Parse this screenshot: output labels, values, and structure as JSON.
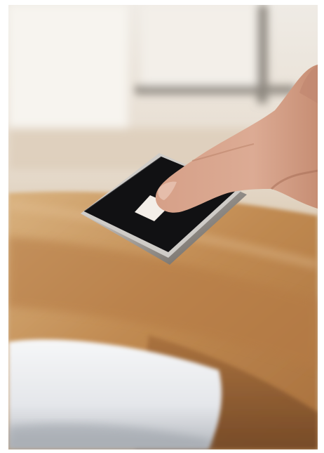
{
  "photo": {
    "subject": "finger-tapping-remote-control",
    "colors": {
      "page_background": "#ffffff",
      "bright_background": "#ece5da",
      "window_frame": "#7d7770",
      "wood_light": "#d6ad7d",
      "wood_mid": "#b98550",
      "wood_dark": "#7e4f2a",
      "pillow_white": "#f1f2f4",
      "pillow_shadow": "#aeb2b8",
      "device_black": "#121214",
      "device_chrome": "#c9c6c2",
      "touch_square": "#f3eee8",
      "skin": "#d9a58c",
      "skin_shadow": "#b87f66"
    }
  }
}
